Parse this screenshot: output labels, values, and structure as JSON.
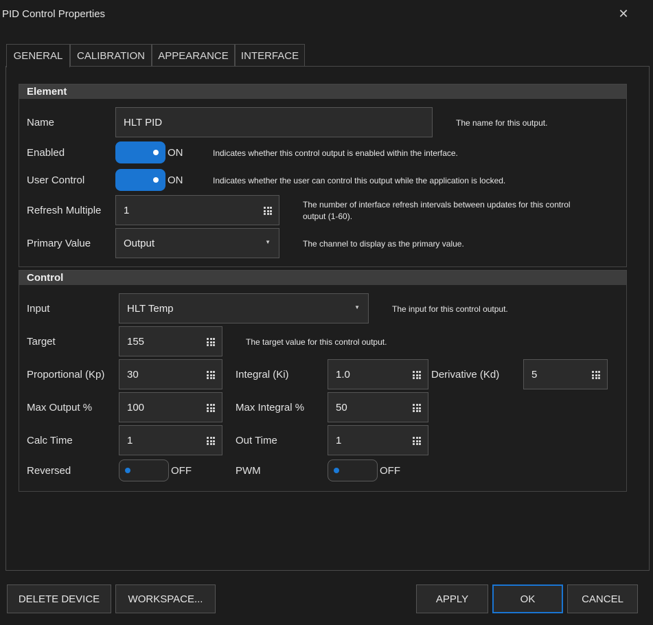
{
  "window": {
    "title": "PID Control Properties"
  },
  "tabs": [
    {
      "label": "GENERAL",
      "active": true
    },
    {
      "label": "CALIBRATION"
    },
    {
      "label": "APPEARANCE"
    },
    {
      "label": "INTERFACE"
    }
  ],
  "element": {
    "header": "Element",
    "name": {
      "label": "Name",
      "value": "HLT PID",
      "help": "The name for this output."
    },
    "enabled": {
      "label": "Enabled",
      "state": "ON",
      "help": "Indicates whether this control output is enabled within the interface."
    },
    "user_control": {
      "label": "User Control",
      "state": "ON",
      "help": "Indicates whether the user can control this output while the application is locked."
    },
    "refresh_multiple": {
      "label": "Refresh Multiple",
      "value": "1",
      "help_line1": "The number of interface refresh intervals between updates for this control",
      "help_line2": "output (1-60)."
    },
    "primary_value": {
      "label": "Primary Value",
      "value": "Output",
      "help": "The channel to display as the primary value."
    }
  },
  "control": {
    "header": "Control",
    "input": {
      "label": "Input",
      "value": "HLT Temp",
      "help": "The input for this control output."
    },
    "target": {
      "label": "Target",
      "value": "155",
      "help": "The target value for this control output."
    },
    "kp": {
      "label": "Proportional (Kp)",
      "value": "30"
    },
    "ki": {
      "label": "Integral (Ki)",
      "value": "1.0"
    },
    "kd": {
      "label": "Derivative (Kd)",
      "value": "5"
    },
    "max_output": {
      "label": "Max Output %",
      "value": "100"
    },
    "max_integral": {
      "label": "Max Integral %",
      "value": "50"
    },
    "calc_time": {
      "label": "Calc Time",
      "value": "1"
    },
    "out_time": {
      "label": "Out Time",
      "value": "1"
    },
    "reversed": {
      "label": "Reversed",
      "state": "OFF"
    },
    "pwm": {
      "label": "PWM",
      "state": "OFF"
    }
  },
  "buttons": {
    "delete": "DELETE DEVICE",
    "workspace": "WORKSPACE...",
    "apply": "APPLY",
    "ok": "OK",
    "cancel": "CANCEL"
  },
  "icons": {
    "close": "close-icon",
    "numeric": "keypad-icon",
    "dropdown": "chevron-down-icon"
  },
  "colors": {
    "accent": "#1a75d2",
    "background": "#1c1c1c",
    "section_header": "#3d3d3d"
  }
}
